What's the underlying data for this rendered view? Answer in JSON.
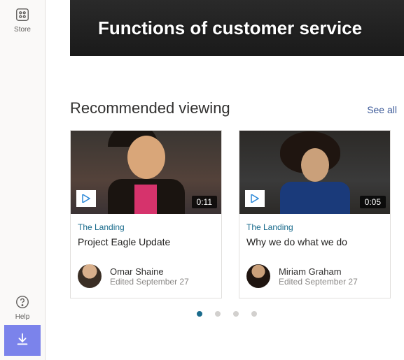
{
  "sidebar": {
    "store_label": "Store",
    "help_label": "Help"
  },
  "hero": {
    "title": "Functions of customer service"
  },
  "recommended": {
    "heading": "Recommended viewing",
    "see_all": "See all",
    "cards": [
      {
        "duration": "0:11",
        "category": "The Landing",
        "title": "Project Eagle Update",
        "author": "Omar Shaine",
        "edited": "Edited September 27"
      },
      {
        "duration": "0:05",
        "category": "The Landing",
        "title": "Why we do what we do",
        "author": "Miriam Graham",
        "edited": "Edited September 27"
      }
    ]
  },
  "carousel": {
    "active_index": 0,
    "total": 4
  }
}
